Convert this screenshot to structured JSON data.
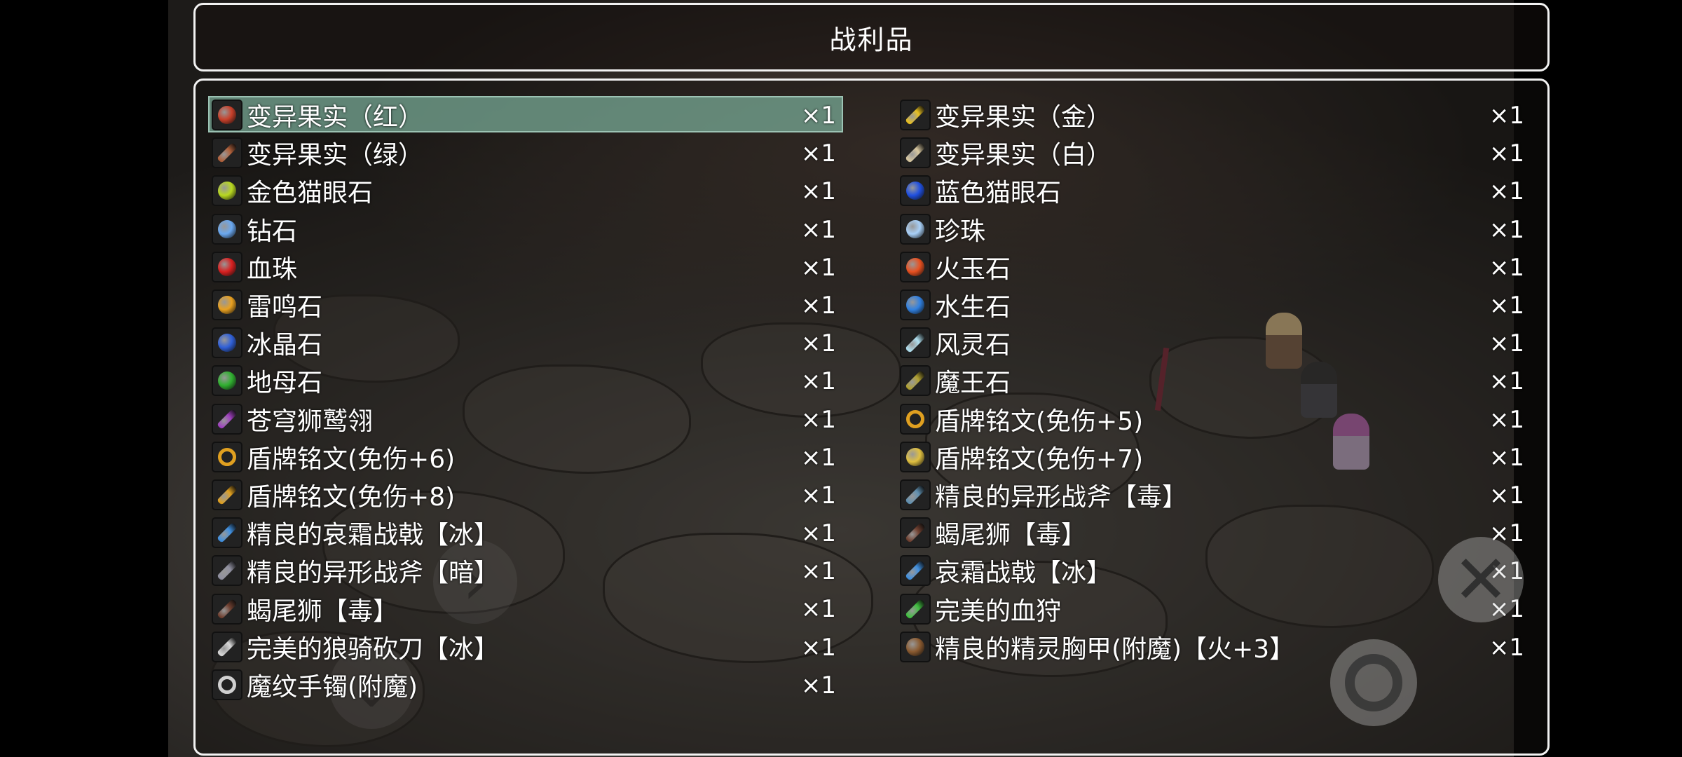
{
  "title": "战利品",
  "left_items": [
    {
      "name": "变异果实（红）",
      "qty": "×1",
      "icon": "red-fruit-icon",
      "color": "#c8402a",
      "shape": "ball",
      "selected": true
    },
    {
      "name": "变异果实（绿）",
      "qty": "×1",
      "icon": "green-fruit-icon",
      "color": "#b0603a",
      "shape": "bar"
    },
    {
      "name": "金色猫眼石",
      "qty": "×1",
      "icon": "gold-cats-eye-icon",
      "color": "#b8d820",
      "shape": "ball"
    },
    {
      "name": "钻石",
      "qty": "×1",
      "icon": "diamond-icon",
      "color": "#6aa8f0",
      "shape": "ball"
    },
    {
      "name": "血珠",
      "qty": "×1",
      "icon": "blood-pearl-icon",
      "color": "#d82020",
      "shape": "ball"
    },
    {
      "name": "雷鸣石",
      "qty": "×1",
      "icon": "thunder-stone-icon",
      "color": "#e8a020",
      "shape": "ball"
    },
    {
      "name": "冰晶石",
      "qty": "×1",
      "icon": "ice-crystal-icon",
      "color": "#3060d8",
      "shape": "ball"
    },
    {
      "name": "地母石",
      "qty": "×1",
      "icon": "earth-stone-icon",
      "color": "#30b030",
      "shape": "ball"
    },
    {
      "name": "苍穹狮鹫翎",
      "qty": "×1",
      "icon": "feather-icon",
      "color": "#a040c0",
      "shape": "bar"
    },
    {
      "name": "盾牌铭文(免伤+6)",
      "qty": "×1",
      "icon": "rune-icon",
      "color": "#e0a020",
      "shape": "ring"
    },
    {
      "name": "盾牌铭文(免伤+8)",
      "qty": "×1",
      "icon": "rune-icon",
      "color": "#e0a020",
      "shape": "bar"
    },
    {
      "name": "精良的哀霜战戟【冰】",
      "qty": "×1",
      "icon": "halberd-icon",
      "color": "#4090e0",
      "shape": "bar"
    },
    {
      "name": "精良的异形战斧【暗】",
      "qty": "×1",
      "icon": "axe-icon",
      "color": "#9090a0",
      "shape": "bar"
    },
    {
      "name": "蝎尾狮【毒】",
      "qty": "×1",
      "icon": "spear-icon",
      "color": "#704030",
      "shape": "bar"
    },
    {
      "name": "完美的狼骑砍刀【冰】",
      "qty": "×1",
      "icon": "blade-icon",
      "color": "#d8d8d8",
      "shape": "bar"
    },
    {
      "name": "魔纹手镯(附魔)",
      "qty": "×1",
      "icon": "bracelet-icon",
      "color": "#d0d0d0",
      "shape": "ring"
    }
  ],
  "right_items": [
    {
      "name": "变异果实（金）",
      "qty": "×1",
      "icon": "gold-fruit-icon",
      "color": "#e8c020",
      "shape": "bar"
    },
    {
      "name": "变异果实（白）",
      "qty": "×1",
      "icon": "white-fruit-icon",
      "color": "#d8c8a0",
      "shape": "bar"
    },
    {
      "name": "蓝色猫眼石",
      "qty": "×1",
      "icon": "blue-cats-eye-icon",
      "color": "#2050e0",
      "shape": "ball"
    },
    {
      "name": "珍珠",
      "qty": "×1",
      "icon": "pearl-icon",
      "color": "#a8d0f8",
      "shape": "ball"
    },
    {
      "name": "火玉石",
      "qty": "×1",
      "icon": "fire-jade-icon",
      "color": "#e85020",
      "shape": "ball"
    },
    {
      "name": "水生石",
      "qty": "×1",
      "icon": "water-stone-icon",
      "color": "#3080e0",
      "shape": "ball"
    },
    {
      "name": "风灵石",
      "qty": "×1",
      "icon": "wind-stone-icon",
      "color": "#b0e0f0",
      "shape": "bar"
    },
    {
      "name": "魔王石",
      "qty": "×1",
      "icon": "demon-stone-icon",
      "color": "#b0a030",
      "shape": "bar"
    },
    {
      "name": "盾牌铭文(免伤+5)",
      "qty": "×1",
      "icon": "rune-icon",
      "color": "#e0a020",
      "shape": "ring"
    },
    {
      "name": "盾牌铭文(免伤+7)",
      "qty": "×1",
      "icon": "rune-icon",
      "color": "#e0c040",
      "shape": "ball"
    },
    {
      "name": "精良的异形战斧【毒】",
      "qty": "×1",
      "icon": "axe-icon",
      "color": "#6090b0",
      "shape": "bar"
    },
    {
      "name": "蝎尾狮【毒】",
      "qty": "×1",
      "icon": "spear-icon",
      "color": "#704030",
      "shape": "bar"
    },
    {
      "name": "哀霜战戟【冰】",
      "qty": "×1",
      "icon": "halberd-icon",
      "color": "#4090e0",
      "shape": "bar"
    },
    {
      "name": "完美的血狩",
      "qty": "×1",
      "icon": "sword-icon",
      "color": "#40c040",
      "shape": "bar"
    },
    {
      "name": "精良的精灵胸甲(附魔)【火+3】",
      "qty": "×1",
      "icon": "armor-icon",
      "color": "#8a5a30",
      "shape": "ball"
    }
  ]
}
